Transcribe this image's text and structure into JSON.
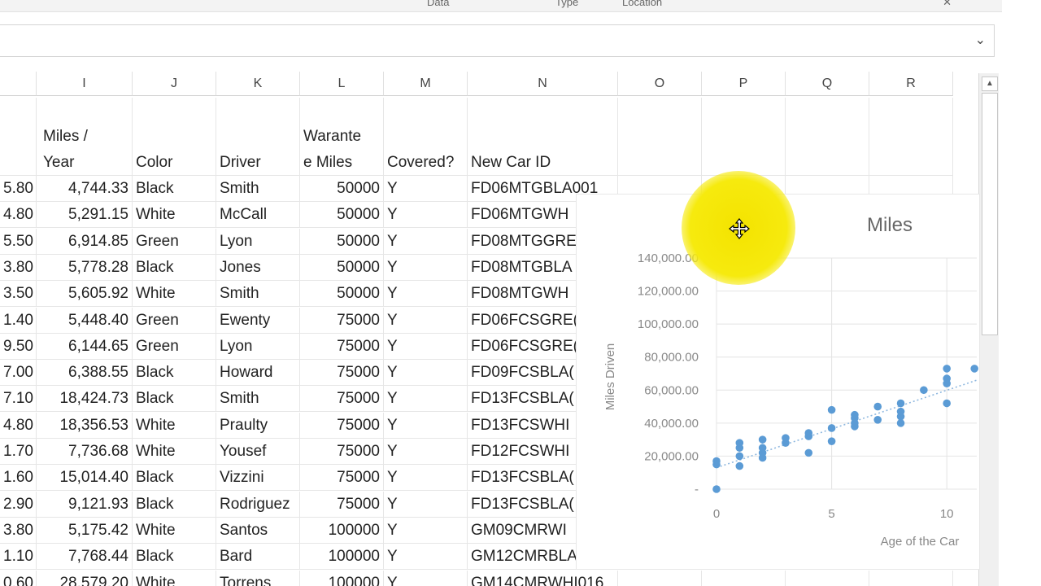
{
  "ribbon": {
    "groups": [
      "Data",
      "Type",
      "Location"
    ],
    "close_icon": "close-icon"
  },
  "formula_bar": {
    "chevron_icon": "chevron-down-icon"
  },
  "columns": [
    "I",
    "J",
    "K",
    "L",
    "M",
    "N",
    "O",
    "P",
    "Q",
    "R"
  ],
  "header_row": {
    "h_partial": "",
    "i": "Miles /\nYear",
    "j": "Color",
    "k": "Driver",
    "l": "Warante\ne Miles",
    "m": "Covered?",
    "n": "New Car ID"
  },
  "rows": [
    {
      "h": "5.80",
      "i": "4,744.33",
      "j": "Black",
      "k": "Smith",
      "l": "50000",
      "m": "Y",
      "n": "FD06MTGBLA001"
    },
    {
      "h": "4.80",
      "i": "5,291.15",
      "j": "White",
      "k": "McCall",
      "l": "50000",
      "m": "Y",
      "n": "FD06MTGWH"
    },
    {
      "h": "5.50",
      "i": "6,914.85",
      "j": "Green",
      "k": "Lyon",
      "l": "50000",
      "m": "Y",
      "n": "FD08MTGGRE"
    },
    {
      "h": "3.80",
      "i": "5,778.28",
      "j": "Black",
      "k": "Jones",
      "l": "50000",
      "m": "Y",
      "n": "FD08MTGBLA"
    },
    {
      "h": "3.50",
      "i": "5,605.92",
      "j": "White",
      "k": "Smith",
      "l": "50000",
      "m": "Y",
      "n": "FD08MTGWH"
    },
    {
      "h": "1.40",
      "i": "5,448.40",
      "j": "Green",
      "k": "Ewenty",
      "l": "75000",
      "m": "Y",
      "n": "FD06FCSGRE("
    },
    {
      "h": "9.50",
      "i": "6,144.65",
      "j": "Green",
      "k": "Lyon",
      "l": "75000",
      "m": "Y",
      "n": "FD06FCSGRE("
    },
    {
      "h": "7.00",
      "i": "6,388.55",
      "j": "Black",
      "k": "Howard",
      "l": "75000",
      "m": "Y",
      "n": "FD09FCSBLA("
    },
    {
      "h": "7.10",
      "i": "18,424.73",
      "j": "Black",
      "k": "Smith",
      "l": "75000",
      "m": "Y",
      "n": "FD13FCSBLA("
    },
    {
      "h": "4.80",
      "i": "18,356.53",
      "j": "White",
      "k": "Praulty",
      "l": "75000",
      "m": "Y",
      "n": "FD13FCSWHI"
    },
    {
      "h": "1.70",
      "i": "7,736.68",
      "j": "White",
      "k": "Yousef",
      "l": "75000",
      "m": "Y",
      "n": "FD12FCSWHI"
    },
    {
      "h": "1.60",
      "i": "15,014.40",
      "j": "Black",
      "k": "Vizzini",
      "l": "75000",
      "m": "Y",
      "n": "FD13FCSBLA("
    },
    {
      "h": "2.90",
      "i": "9,121.93",
      "j": "Black",
      "k": "Rodriguez",
      "l": "75000",
      "m": "Y",
      "n": "FD13FCSBLA("
    },
    {
      "h": "3.80",
      "i": "5,175.42",
      "j": "White",
      "k": "Santos",
      "l": "100000",
      "m": "Y",
      "n": "GM09CMRWI"
    },
    {
      "h": "1.10",
      "i": "7,768.44",
      "j": "Black",
      "k": "Bard",
      "l": "100000",
      "m": "Y",
      "n": "GM12CMRBLA"
    },
    {
      "h": "0.60",
      "i": "28,579.20",
      "j": "White",
      "k": "Torrens",
      "l": "100000",
      "m": "Y",
      "n": "GM14CMRWHI016"
    }
  ],
  "chart_data": {
    "type": "scatter",
    "title": "Miles",
    "xlabel": "Age of the Car",
    "ylabel": "Miles Driven",
    "x_ticks": [
      "0",
      "5",
      "10"
    ],
    "y_ticks": [
      "-",
      "20,000.00",
      "40,000.00",
      "60,000.00",
      "80,000.00",
      "100,000.00",
      "120,000.00",
      "140,000.00"
    ],
    "xlim": [
      0,
      11.3
    ],
    "ylim": [
      0,
      140000
    ],
    "grid": true,
    "trendline": {
      "style": "dotted linear",
      "from": [
        0,
        13000
      ],
      "to": [
        11.3,
        66000
      ]
    },
    "series": [
      {
        "color": "#5b9bd5",
        "points": [
          [
            0,
            0
          ],
          [
            0,
            15000
          ],
          [
            0,
            17000
          ],
          [
            1,
            14000
          ],
          [
            1,
            20000
          ],
          [
            1,
            25000
          ],
          [
            1,
            28000
          ],
          [
            2,
            19000
          ],
          [
            2,
            22000
          ],
          [
            2,
            25000
          ],
          [
            2,
            30000
          ],
          [
            3,
            28000
          ],
          [
            3,
            31000
          ],
          [
            4,
            22000
          ],
          [
            4,
            32000
          ],
          [
            4,
            34000
          ],
          [
            5,
            29000
          ],
          [
            5,
            37000
          ],
          [
            5,
            48000
          ],
          [
            6,
            38000
          ],
          [
            6,
            40000
          ],
          [
            6,
            43000
          ],
          [
            6,
            45000
          ],
          [
            7,
            42000
          ],
          [
            7,
            50000
          ],
          [
            8,
            40000
          ],
          [
            8,
            44000
          ],
          [
            8,
            47000
          ],
          [
            8,
            52000
          ],
          [
            9,
            60000
          ],
          [
            10,
            52000
          ],
          [
            10,
            64000
          ],
          [
            10,
            67000
          ],
          [
            10,
            73000
          ],
          [
            11.2,
            73000
          ]
        ]
      }
    ]
  },
  "overlay": {
    "highlight_color": "#f5e600",
    "cursor_icon": "move-cursor-icon"
  }
}
